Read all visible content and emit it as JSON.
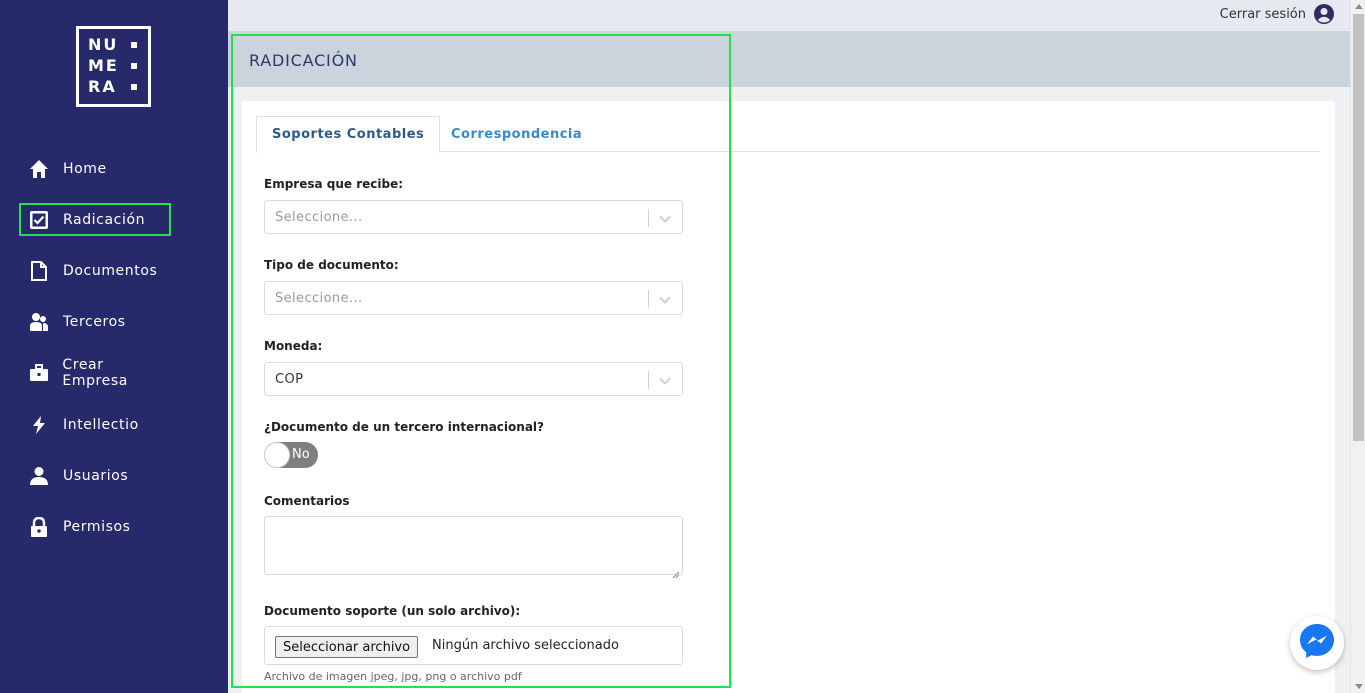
{
  "sidebar": {
    "logo": {
      "rows": [
        "NU",
        "ME",
        "RA"
      ]
    },
    "items": [
      {
        "label": "Home",
        "icon": "home-icon"
      },
      {
        "label": "Radicación",
        "icon": "checkbox-icon",
        "active": true
      },
      {
        "label": "Documentos",
        "icon": "document-icon"
      },
      {
        "label": "Terceros",
        "icon": "people-icon"
      },
      {
        "label": "Crear Empresa",
        "icon": "briefcase-icon"
      },
      {
        "label": "Intellectio",
        "icon": "bolt-icon"
      },
      {
        "label": "Usuarios",
        "icon": "user-icon"
      },
      {
        "label": "Permisos",
        "icon": "lock-icon"
      }
    ]
  },
  "topbar": {
    "logout_label": "Cerrar sesión"
  },
  "page": {
    "title": "RADICACIÓN"
  },
  "tabs": [
    {
      "label": "Soportes Contables",
      "active": true
    },
    {
      "label": "Correspondencia",
      "active": false
    }
  ],
  "form": {
    "empresa": {
      "label": "Empresa que recibe:",
      "value": "Seleccione..."
    },
    "tipo_documento": {
      "label": "Tipo de documento:",
      "value": "Seleccione..."
    },
    "moneda": {
      "label": "Moneda:",
      "value": "COP"
    },
    "internacional": {
      "label": "¿Documento de un tercero internacional?",
      "toggle_text": "No",
      "on": false
    },
    "comentarios": {
      "label": "Comentarios",
      "value": ""
    },
    "soporte": {
      "label": "Documento soporte (un solo archivo):",
      "button": "Seleccionar archivo",
      "status": "Ningún archivo seleccionado",
      "hint": "Archivo de imagen jpeg, jpg, png o archivo pdf"
    }
  },
  "colors": {
    "sidebar_bg": "#262a6a",
    "highlight": "#22e14a",
    "tab_active": "#2d5a88",
    "tab_inactive": "#3a8ac8",
    "messenger": "#1877f2"
  }
}
